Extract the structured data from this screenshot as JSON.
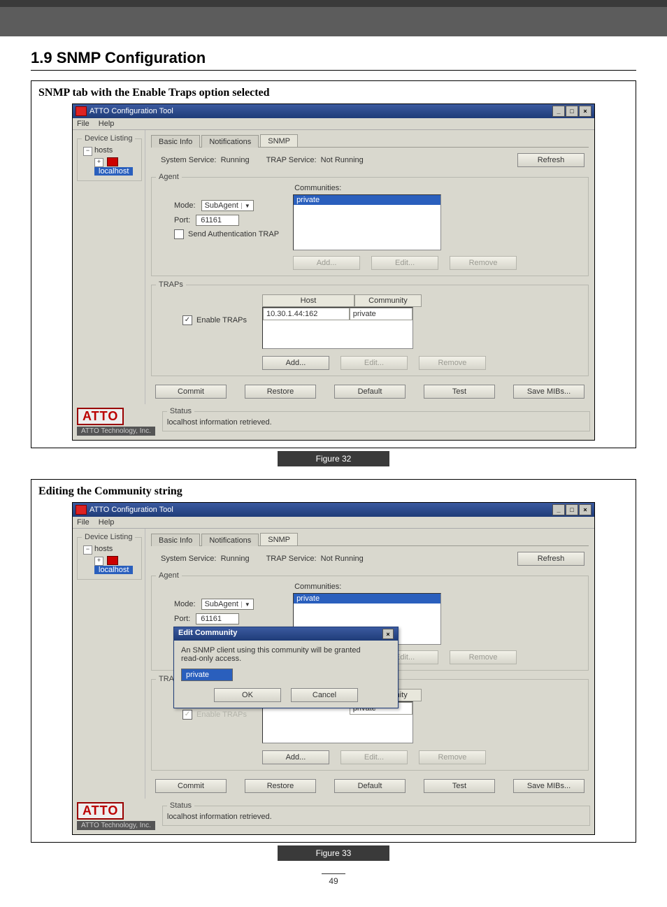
{
  "section_heading": "1.9 SNMP Configuration",
  "page_number": "49",
  "figures": [
    {
      "title": "SNMP tab with the Enable Traps option selected",
      "label": "Figure 32"
    },
    {
      "title": "Editing the Community string",
      "label": "Figure 33"
    }
  ],
  "app": {
    "window_title": "ATTO Configuration Tool",
    "menus": [
      "File",
      "Help"
    ],
    "window_controls": {
      "min": "_",
      "max": "□",
      "close": "×"
    },
    "device_listing_legend": "Device Listing",
    "tree": {
      "expander_minus": "−",
      "expander_plus": "+",
      "root": "hosts",
      "node": "localhost"
    },
    "tabs": [
      "Basic Info",
      "Notifications",
      "SNMP"
    ],
    "active_tab": 2,
    "status_line": {
      "sys_label": "System Service:",
      "sys_value": "Running",
      "trap_label": "TRAP Service:",
      "trap_value": "Not Running",
      "refresh": "Refresh"
    },
    "agent": {
      "legend": "Agent",
      "communities_label": "Communities:",
      "mode_label": "Mode:",
      "mode_value": "SubAgent",
      "port_label": "Port:",
      "port_value": "61161",
      "send_auth_label": "Send Authentication TRAP",
      "send_auth_checked": false,
      "list_items": [
        "private"
      ],
      "btn_add": "Add...",
      "btn_edit": "Edit...",
      "btn_remove": "Remove"
    },
    "traps": {
      "legend": "TRAPs",
      "enable_label": "Enable TRAPs",
      "enable_checked": true,
      "col_host": "Host",
      "col_comm": "Community",
      "rows": [
        {
          "host": "10.30.1.44:162",
          "community": "private"
        }
      ],
      "btn_add": "Add...",
      "btn_edit": "Edit...",
      "btn_remove": "Remove"
    },
    "bottom_buttons": {
      "commit": "Commit",
      "restore": "Restore",
      "default": "Default",
      "test": "Test",
      "save_mibs": "Save MIBs..."
    },
    "status": {
      "legend": "Status",
      "logo_text": "ATTO",
      "logo_sub": "ATTO Technology, Inc.",
      "message": "localhost information retrieved."
    }
  },
  "dialog": {
    "title": "Edit Community",
    "close": "×",
    "message1": "An SNMP client using this community will be granted",
    "message2": "read-only access.",
    "input_value": "private",
    "btn_ok": "OK",
    "btn_cancel": "Cancel",
    "ghost_send_auth": "Send Authentication TRAP",
    "ghost_enable": "Enable TRAPs"
  }
}
